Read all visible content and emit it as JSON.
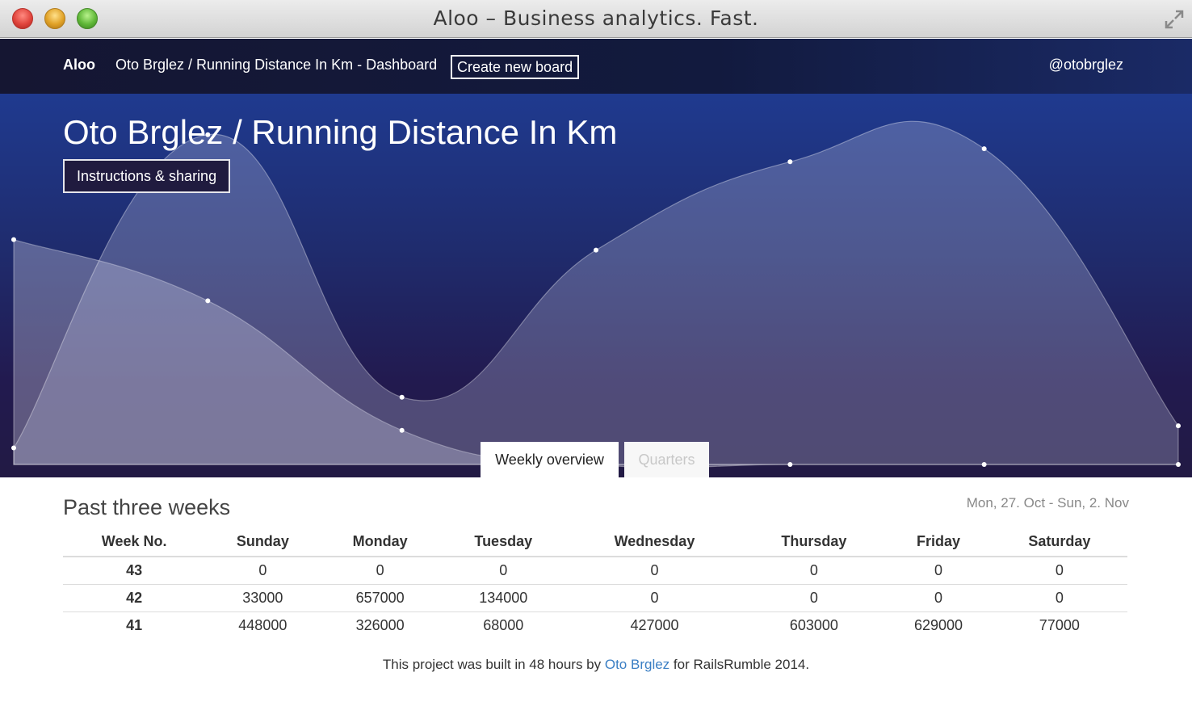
{
  "window": {
    "title": "Aloo – Business analytics. Fast."
  },
  "navbar": {
    "brand": "Aloo",
    "breadcrumb": "Oto Brglez / Running Distance In Km - Dashboard",
    "create_button": "Create new board",
    "user": "@otobrglez"
  },
  "hero": {
    "title": "Oto Brglez / Running Distance In Km",
    "instructions_button": "Instructions & sharing",
    "tabs": [
      {
        "label": "Weekly overview",
        "active": true
      },
      {
        "label": "Quarters",
        "active": false
      }
    ]
  },
  "chart_data": {
    "type": "area",
    "series": [
      {
        "values": [
          448000,
          326000,
          68000,
          0,
          0,
          0,
          0
        ]
      },
      {
        "values": [
          33000,
          657000,
          134000,
          427000,
          603000,
          629000,
          77000
        ]
      }
    ],
    "ylim": [
      0,
      700000
    ],
    "grid": false
  },
  "section": {
    "title": "Past three weeks",
    "date_range": "Mon, 27. Oct - Sun, 2. Nov"
  },
  "table": {
    "columns": [
      "Week No.",
      "Sunday",
      "Monday",
      "Tuesday",
      "Wednesday",
      "Thursday",
      "Friday",
      "Saturday"
    ],
    "rows": [
      [
        "43",
        "0",
        "0",
        "0",
        "0",
        "0",
        "0",
        "0"
      ],
      [
        "42",
        "33000",
        "657000",
        "134000",
        "0",
        "0",
        "0",
        "0"
      ],
      [
        "41",
        "448000",
        "326000",
        "68000",
        "427000",
        "603000",
        "629000",
        "77000"
      ]
    ]
  },
  "footer": {
    "prefix": "This project was built in 48 hours by ",
    "link": "Oto Brglez",
    "suffix": " for RailsRumble 2014."
  }
}
